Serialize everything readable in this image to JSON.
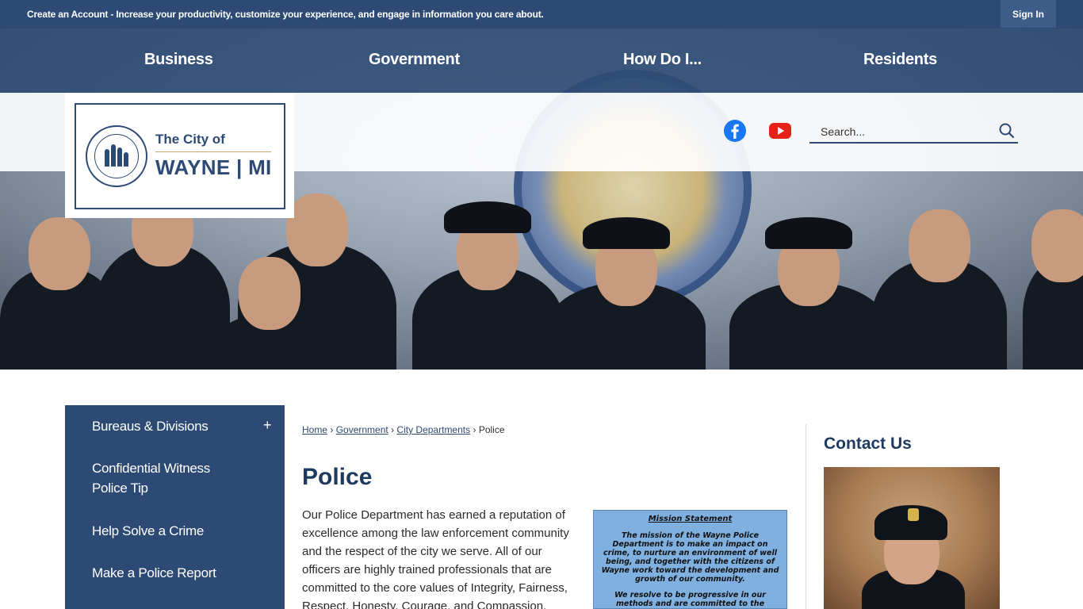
{
  "topbar": {
    "message": "Create an Account - Increase your productivity, customize your experience, and engage in information you care about.",
    "signin_label": "Sign In"
  },
  "nav": {
    "items": [
      {
        "label": "Business"
      },
      {
        "label": "Government"
      },
      {
        "label": "How Do I..."
      },
      {
        "label": "Residents"
      }
    ]
  },
  "logo": {
    "small": "The City of",
    "big": "WAYNE | MI"
  },
  "social": {
    "facebook_icon": "facebook-icon",
    "youtube_icon": "youtube-icon",
    "facebook_color": "#1877f2",
    "youtube_color": "#e62117"
  },
  "search": {
    "placeholder": "Search..."
  },
  "sidebar": {
    "items": [
      {
        "label": "Bureaus & Divisions"
      },
      {
        "label": "Confidential Witness Police Tip"
      },
      {
        "label": "Help Solve a Crime"
      },
      {
        "label": "Make a Police Report"
      }
    ],
    "expand_symbol": "+"
  },
  "breadcrumb": {
    "items": [
      "Home",
      "Government",
      "City Departments"
    ],
    "current": "Police",
    "separator": "›"
  },
  "main": {
    "title": "Police",
    "body": "Our Police Department has earned a reputation of excellence among the law enforcement community and the respect of the city we serve. All of our officers are highly trained professionals that are committed to the core values of Integrity, Fairness, Respect, Honesty, Courage, and Compassion."
  },
  "mission": {
    "title": "Mission Statement",
    "text1": "The mission of the Wayne Police Department is to make an impact on crime, to nurture an environment of well being, and together with the citizens of Wayne work toward the development and growth of our community.",
    "text2": "We resolve to be progressive in our methods and are committed to the principles of community policing. We will aggressively investigate crime, actively seek"
  },
  "contact": {
    "title": "Contact Us"
  },
  "colors": {
    "brand_navy": "#2c4a73",
    "heading_navy": "#1f3a5f",
    "accent_gold": "#c9a86a"
  }
}
